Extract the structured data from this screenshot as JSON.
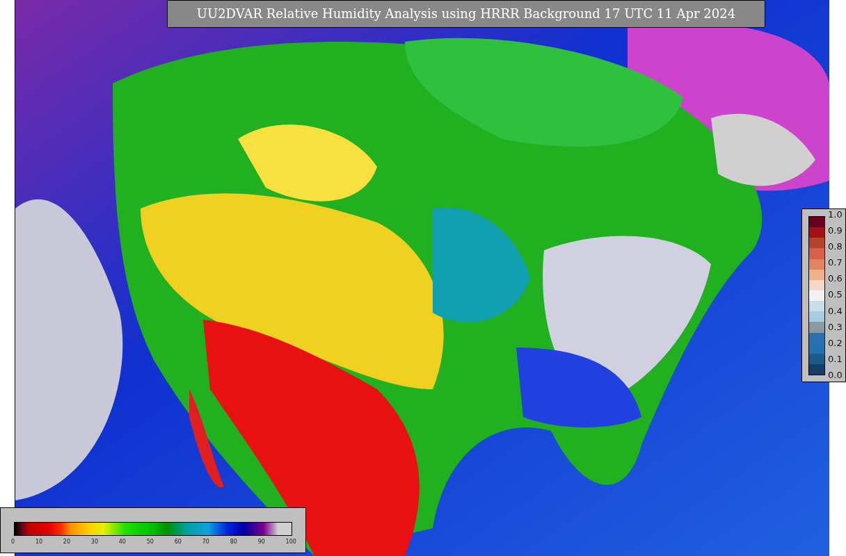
{
  "title": "UU2DVAR Relative Humidity Analysis using HRRR Background 17 UTC 11 Apr 2024",
  "humidity_colorbar": {
    "ticks": [
      "0",
      "10",
      "20",
      "30",
      "40",
      "50",
      "60",
      "70",
      "80",
      "90",
      "100"
    ]
  },
  "station_colorbar": {
    "ticks": [
      "1.0",
      "0.9",
      "0.8",
      "0.7",
      "0.6",
      "0.5",
      "0.4",
      "0.3",
      "0.2",
      "0.1",
      "0.0"
    ]
  }
}
